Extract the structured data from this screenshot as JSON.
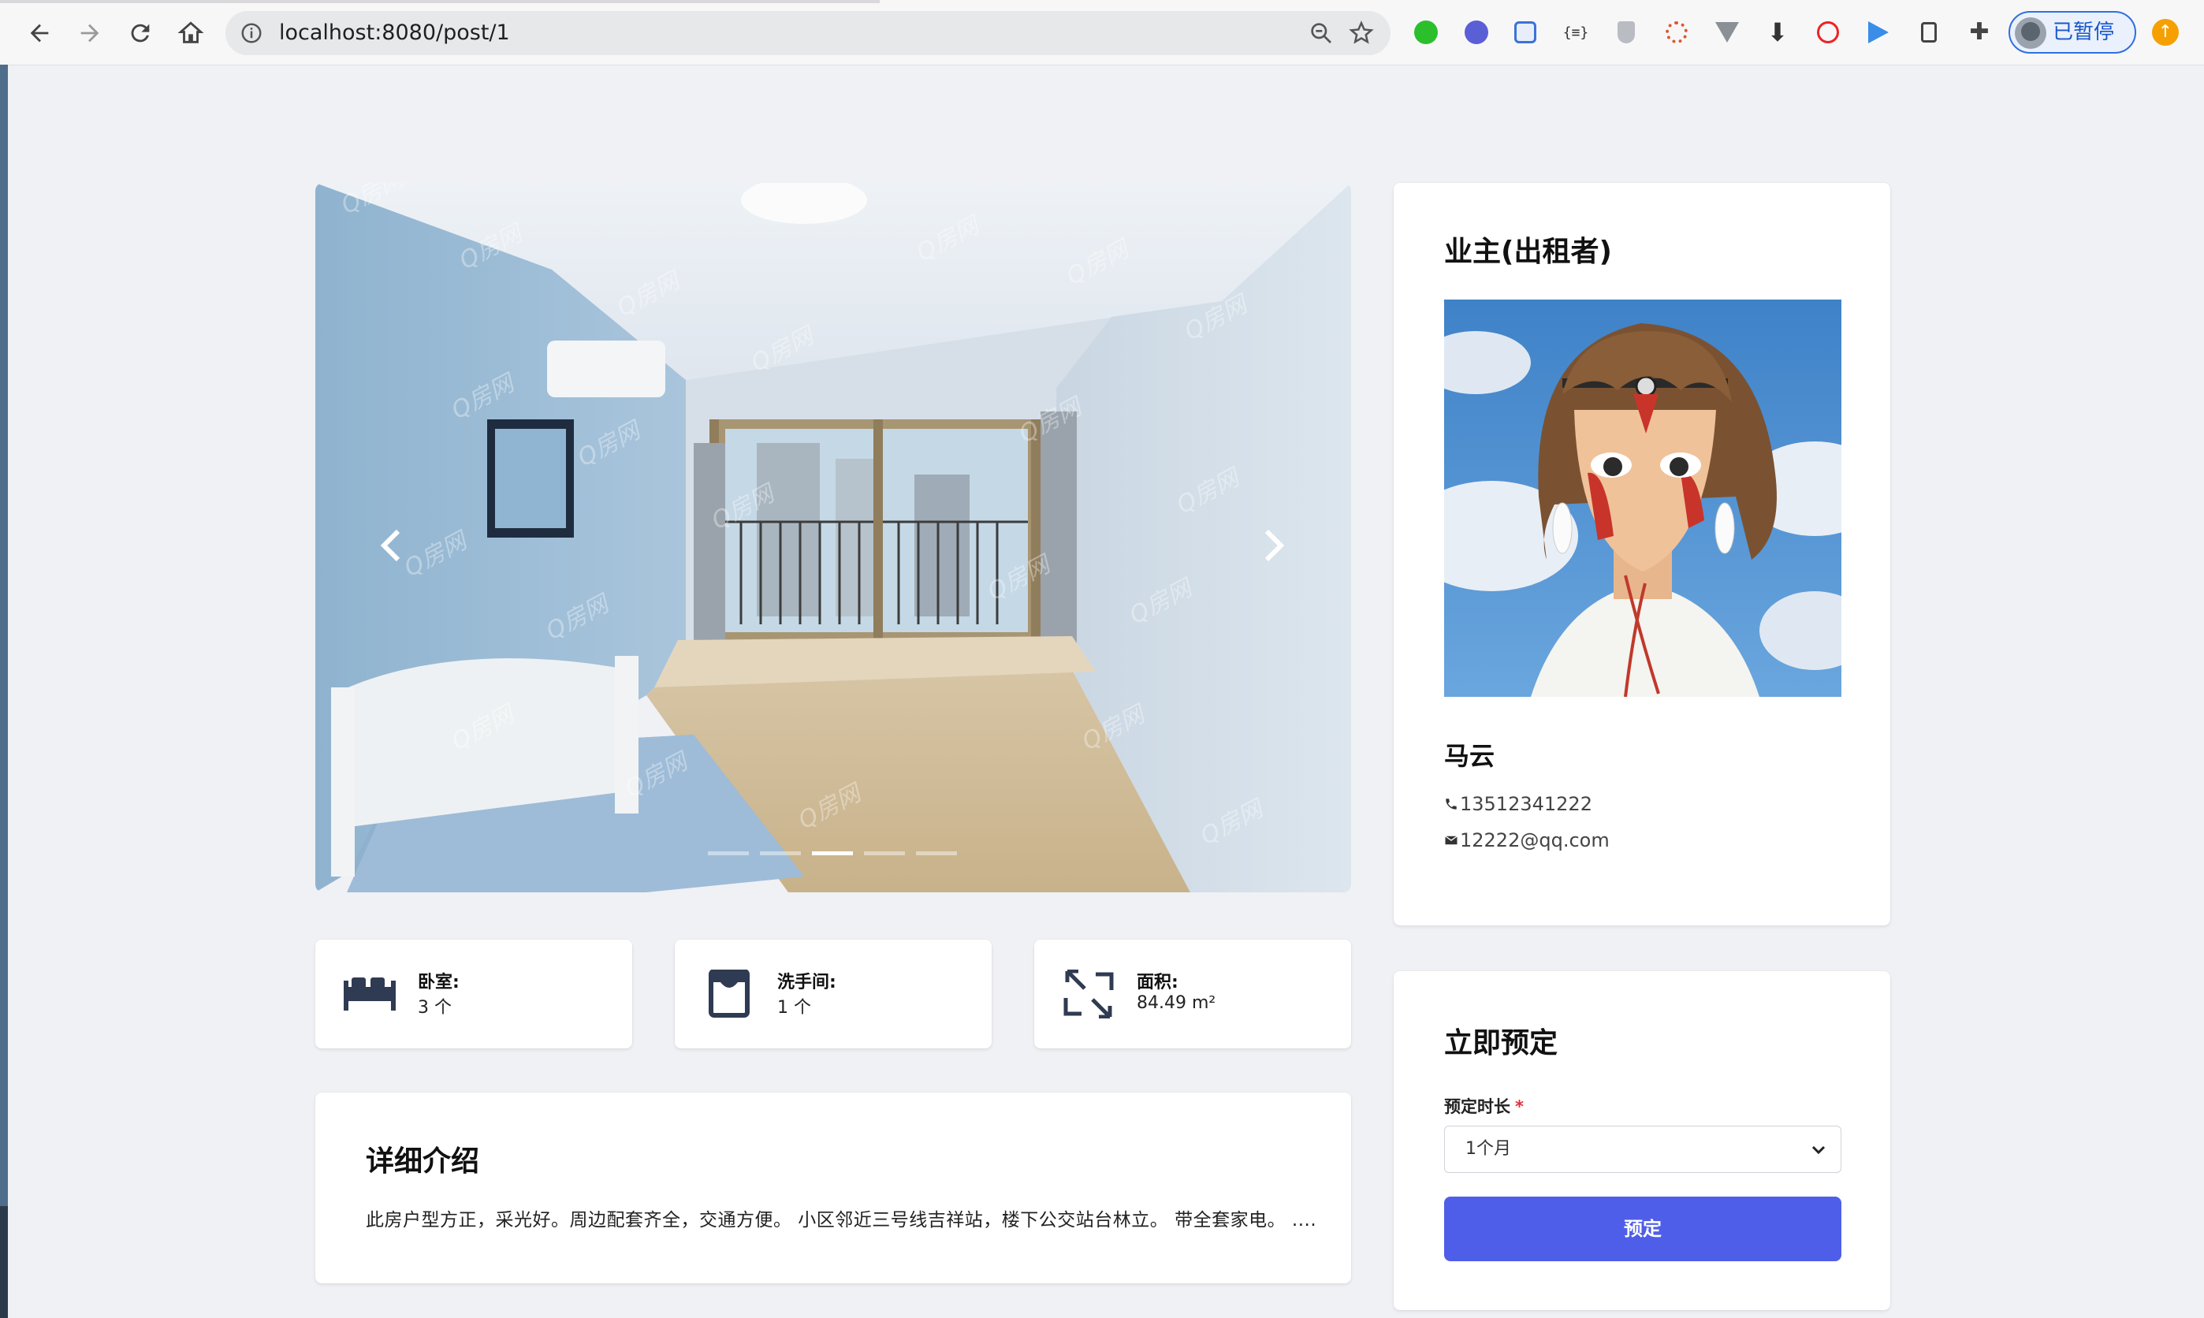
{
  "browser": {
    "url": "localhost:8080/post/1",
    "profile_label": "已暂停",
    "extensions": [
      "green-puzzle-icon",
      "purple-check-icon",
      "translate-icon",
      "json-icon",
      "shield-icon",
      "network-icon",
      "vue-icon",
      "download-icon",
      "flash-icon",
      "arrow-icon",
      "clipboard-icon",
      "puzzle-icon"
    ]
  },
  "carousel": {
    "slide_count": 5,
    "active_slide": 3
  },
  "stats": [
    {
      "label": "卧室:",
      "value": "3 个",
      "icon": "bed-icon"
    },
    {
      "label": "洗手间:",
      "value": "1 个",
      "icon": "bathroom-icon"
    },
    {
      "label": "面积:",
      "value": "84.49 m²",
      "icon": "area-icon"
    }
  ],
  "description": {
    "title": "详细介绍",
    "text": "此房户型方正，采光好。周边配套齐全，交通方便。 小区邻近三号线吉祥站，楼下公交站台林立。 带全套家电。 ...."
  },
  "owner": {
    "title": "业主(出租者)",
    "name": "马云",
    "phone": "13512341222",
    "email": "12222@qq.com"
  },
  "booking": {
    "title": "立即预定",
    "duration_label": "预定时长",
    "required_mark": "*",
    "duration_value": "1个月",
    "submit_label": "预定"
  },
  "colors": {
    "primary_button": "#4f5ee8",
    "page_background": "#f0f1f5",
    "required": "#e0303a"
  }
}
